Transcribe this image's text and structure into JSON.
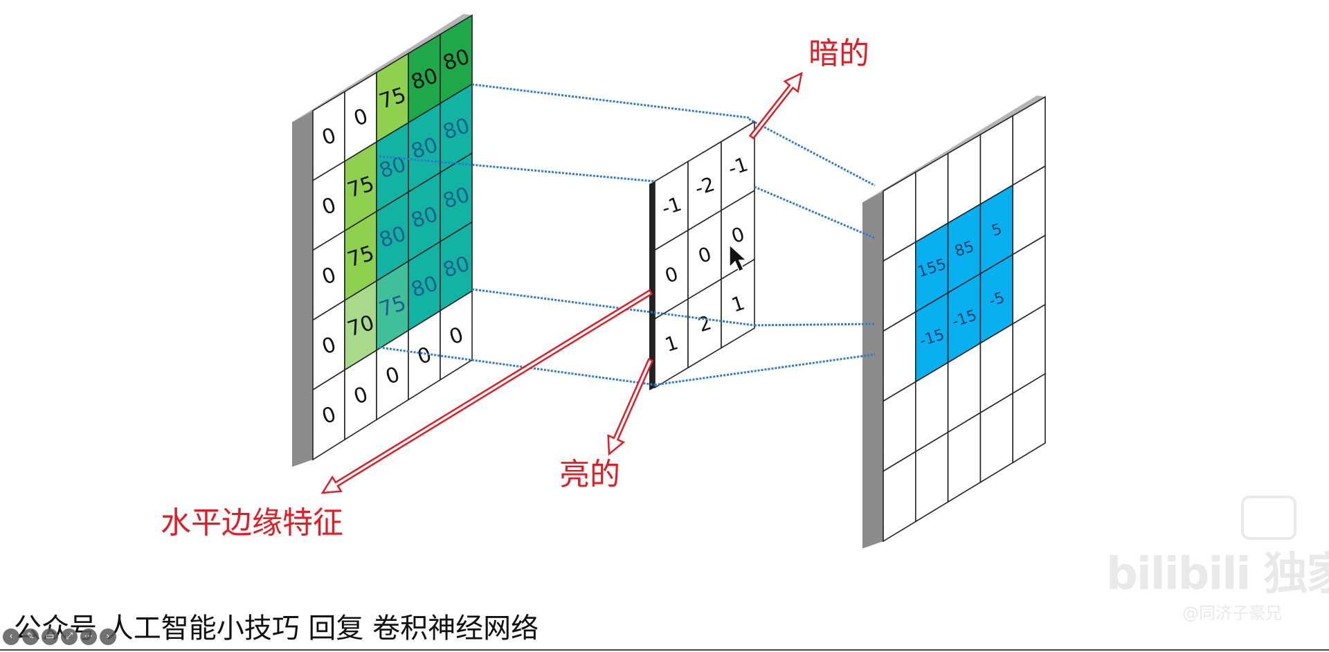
{
  "input_matrix": [
    [
      "0",
      "0",
      "75",
      "80",
      "80"
    ],
    [
      "0",
      "75",
      "80",
      "80",
      "80"
    ],
    [
      "0",
      "75",
      "80",
      "80",
      "80"
    ],
    [
      "0",
      "70",
      "75",
      "80",
      "80"
    ],
    [
      "0",
      "0",
      "0",
      "0",
      "0"
    ]
  ],
  "kernel": [
    [
      "-1",
      "-2",
      "-1"
    ],
    [
      "0",
      "0",
      "0"
    ],
    [
      "1",
      "2",
      "1"
    ]
  ],
  "output_values": [
    [
      "155",
      "85",
      "5"
    ],
    [
      "-15",
      "-15",
      "-5"
    ]
  ],
  "labels": {
    "dark": "暗的",
    "bright": "亮的",
    "horizontal_edge": "水平边缘特征"
  },
  "caption": "公众号 人工智能小技巧 回复 卷积神经网络",
  "watermark": {
    "text": "bilibili 独家",
    "sub": "@同济子豪兄"
  },
  "colors": {
    "annotation": "#e31b23",
    "connector": "#2e7bd1",
    "output_highlight": "#08b0f0",
    "light_green": "#8fd14f",
    "dark_green": "#1fa84a",
    "teal": "#12b3a3",
    "frame": "#8c8c8c"
  },
  "icons": [
    "prev-icon",
    "pen-icon",
    "cc-icon",
    "expand-icon",
    "more-icon",
    "next-icon"
  ]
}
